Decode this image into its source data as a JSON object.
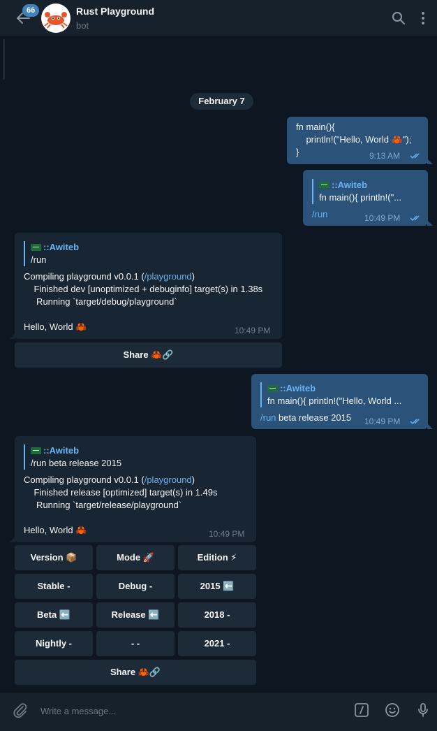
{
  "header": {
    "title": "Rust Playground",
    "subtitle": "bot",
    "unread_count": "66",
    "icons": [
      "back-arrow-icon",
      "search-icon",
      "more-vertical-icon"
    ]
  },
  "date_label": "February 7",
  "messages": {
    "m1": {
      "lines": [
        "fn main(){",
        "    println!(\"Hello, World 🦀\");",
        "}"
      ],
      "time": "9:13 AM"
    },
    "m2": {
      "reply_name": "::Awiteb",
      "reply_text": "fn main(){     println!(\"...",
      "command": "/run",
      "time": "10:49 PM"
    },
    "m3": {
      "reply_name": "::Awiteb",
      "reply_text": "/run",
      "lines": [
        "Compiling playground v0.0.1 (",
        "/playground",
        ")",
        "    Finished dev [unoptimized + debuginfo] target(s) in 1.38s",
        "     Running `target/debug/playground`",
        "Hello, World 🦀"
      ],
      "time": "10:49 PM",
      "share_label": "Share 🦀🔗"
    },
    "m4": {
      "reply_name": "::Awiteb",
      "reply_text": "fn main(){     println!(\"Hello, World ...",
      "command": "/run",
      "command_rest": " beta release 2015",
      "time": "10:49 PM"
    },
    "m5": {
      "reply_name": "::Awiteb",
      "reply_text": "/run beta release 2015",
      "lines": [
        "Compiling playground v0.0.1 (",
        "/playground",
        ")",
        "    Finished release [optimized] target(s) in 1.49s",
        "     Running `target/release/playground`",
        "Hello, World 🦀"
      ],
      "time": "10:49 PM"
    }
  },
  "keyboard": {
    "row1": [
      "Version 📦",
      "Mode  🚀",
      "Edition  ⚡"
    ],
    "row2": [
      "Stable -",
      "Debug -",
      "2015 ⬅️"
    ],
    "row3": [
      "Beta ⬅️",
      "Release ⬅️",
      "2018 -"
    ],
    "row4": [
      "Nightly -",
      "- -",
      "2021 -"
    ],
    "share": "Share 🦀🔗"
  },
  "composer": {
    "placeholder": "Write a message...",
    "icons": [
      "attach-icon",
      "bot-command-icon",
      "emoji-icon",
      "microphone-icon"
    ]
  },
  "colors": {
    "background": "#0e1621",
    "header": "#17212b",
    "outgoing_bubble": "#2b5278",
    "incoming_bubble": "#182533",
    "link": "#6ab3f3",
    "badge": "#4082bc"
  }
}
